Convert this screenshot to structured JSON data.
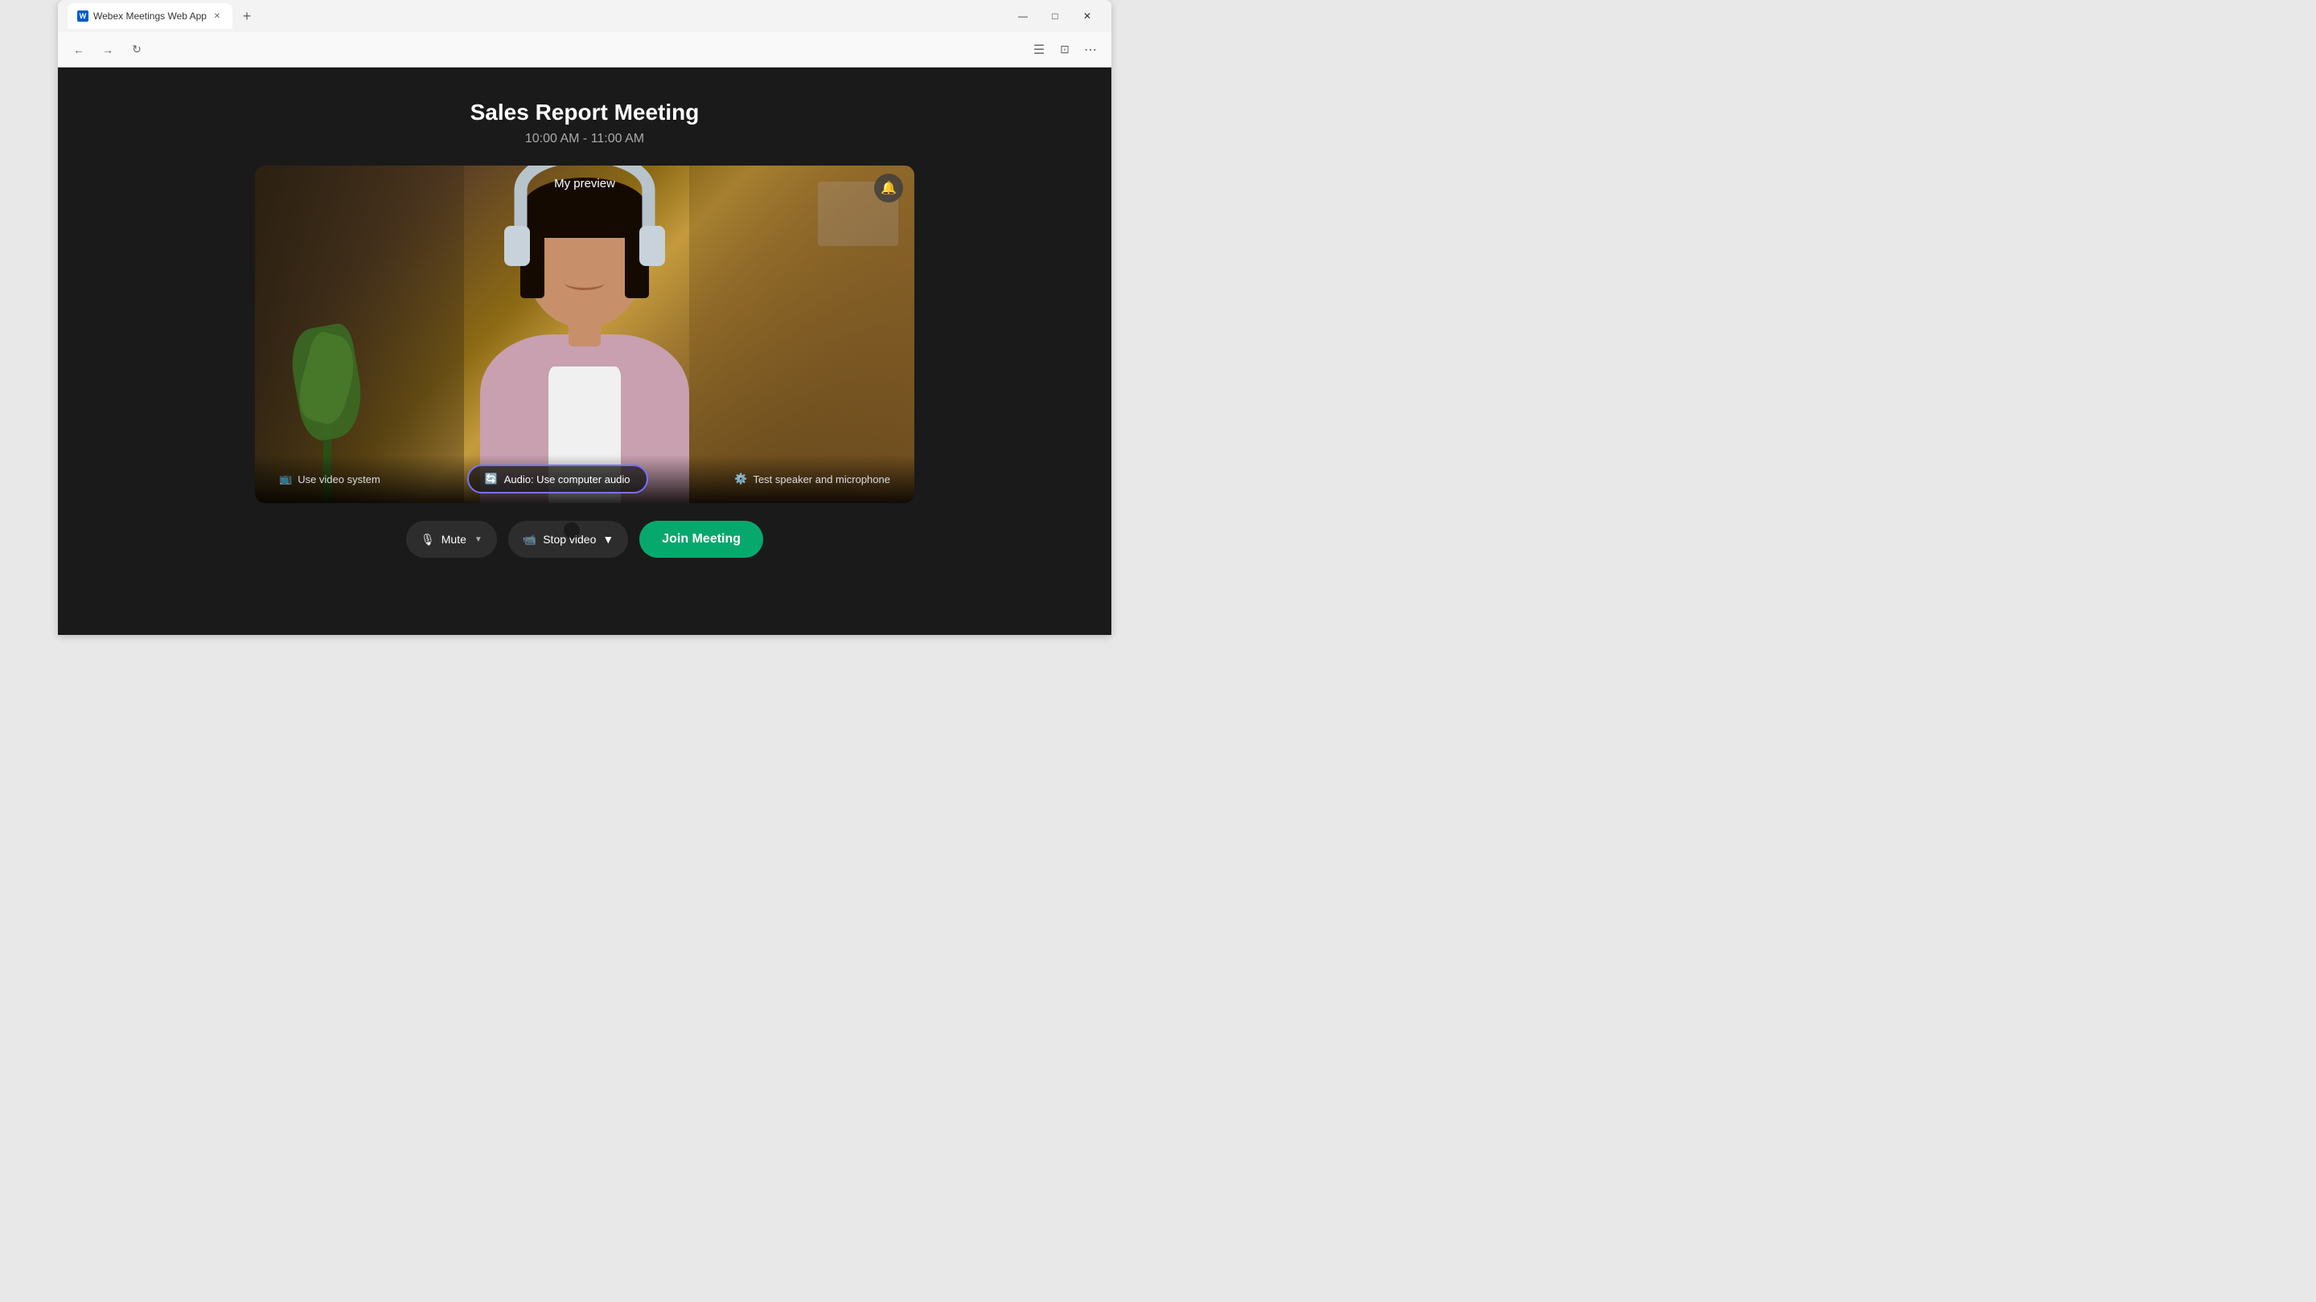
{
  "browser": {
    "tab_title": "Webex Meetings Web App",
    "new_tab_label": "+",
    "window_controls": {
      "minimize": "—",
      "maximize": "□",
      "close": "✕"
    },
    "toolbar": {
      "back": "←",
      "forward": "→",
      "refresh": "↻"
    }
  },
  "app": {
    "meeting_title": "Sales Report Meeting",
    "meeting_time": "10:00 AM - 11:00 AM",
    "preview_label": "My preview",
    "audio_indicator_icon": "🔔",
    "controls": {
      "use_video_system": "Use video system",
      "audio_label": "Audio: Use computer audio",
      "test_speaker": "Test speaker and microphone"
    },
    "bottom_bar": {
      "mute_label": "Mute",
      "stop_video_label": "Stop video",
      "join_label": "Join Meeting"
    }
  }
}
